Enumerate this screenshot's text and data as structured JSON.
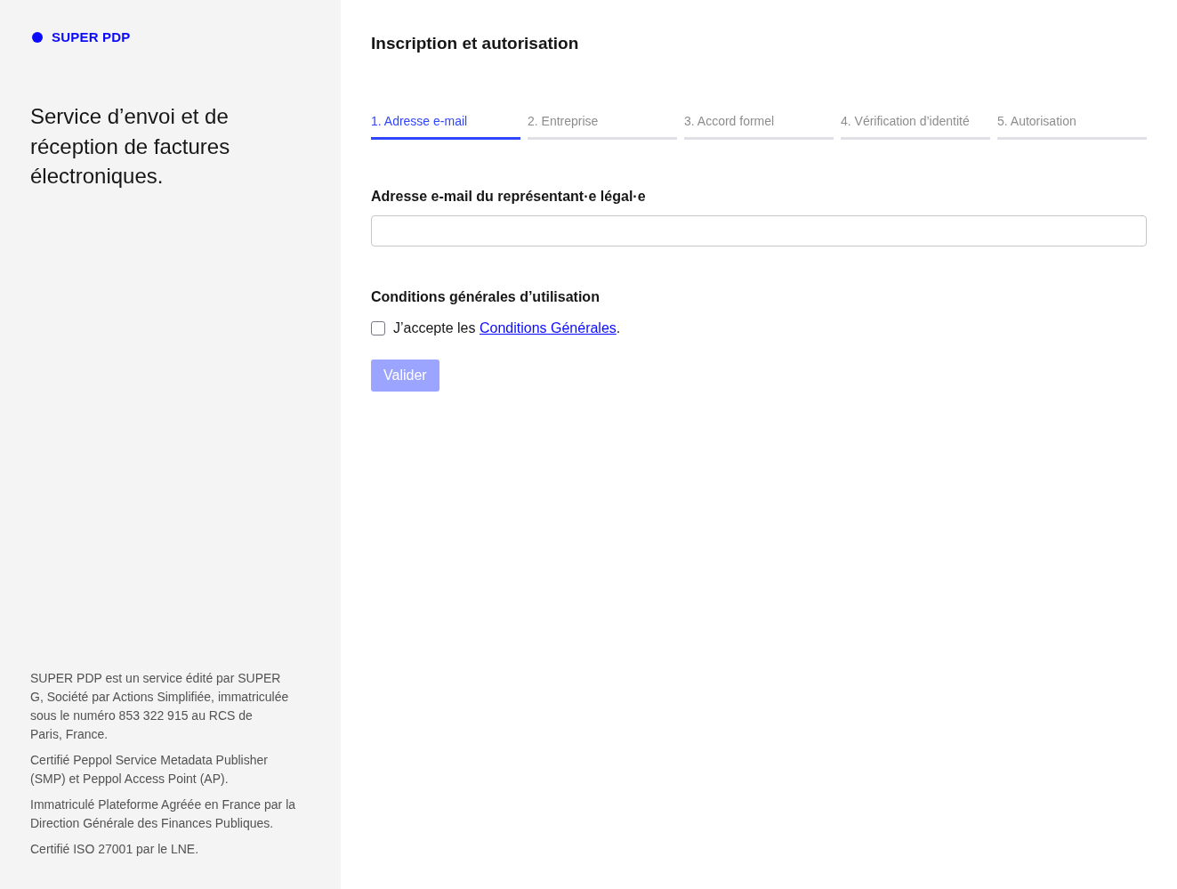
{
  "sidebar": {
    "logo": "SUPER PDP",
    "tagline": "Service d’envoi et de réception de factures électroniques.",
    "footer": [
      "SUPER PDP est un service édité par SUPER G, Société par Actions Simplifiée, immatriculée sous le numéro 853 322 915 au RCS de Paris, France.",
      "Certifié Peppol Service Metadata Publisher (SMP) et Peppol Access Point (AP).",
      "Immatriculé Plateforme Agréée en France par la Direction Générale des Finances Publiques.",
      "Certifié ISO 27001 par le LNE."
    ]
  },
  "main": {
    "title": "Inscription et autorisation",
    "steps": [
      {
        "label": "1. Adresse e-mail",
        "selected": true
      },
      {
        "label": "2. Entreprise",
        "selected": false
      },
      {
        "label": "3. Accord formel",
        "selected": false
      },
      {
        "label": "4. Vérification d’identité",
        "selected": false
      },
      {
        "label": "5. Autorisation",
        "selected": false
      }
    ],
    "email": {
      "label": "Adresse e-mail du représentant·e légal·e"
    },
    "terms": {
      "heading": "Conditions générales d’utilisation",
      "checked": false,
      "text_before": "J’accepte les",
      "link": "Conditions Générales",
      "text_after": "."
    },
    "submit": {
      "label": "Valider",
      "disabled": true
    }
  }
}
